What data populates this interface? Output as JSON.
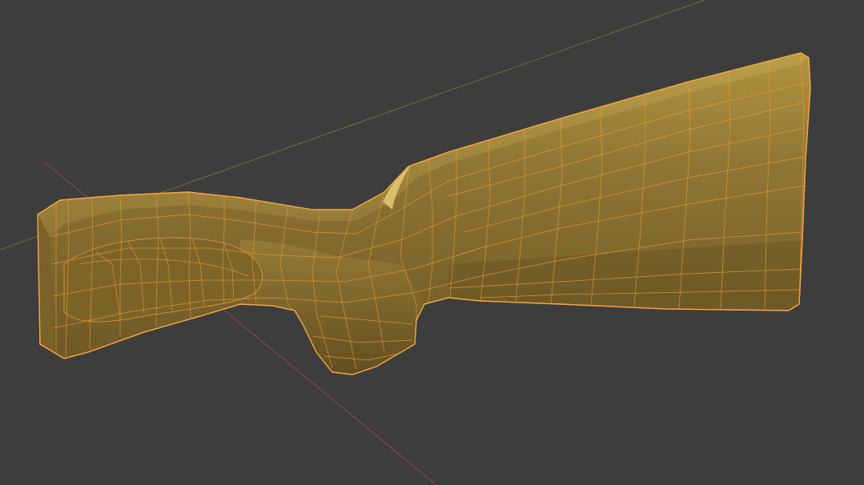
{
  "viewport": {
    "background_color": "#3d3d3d",
    "mode": "edit-mode-wireframe-on-shaded",
    "axes": {
      "x_axis_color": "#9a4a5c",
      "y_axis_color": "#6e7a44"
    },
    "object": {
      "type": "mesh",
      "depicts": "rifle-buttstock",
      "surface_color": "#8c7434",
      "wire_color": "#f09a32",
      "selected": true
    }
  }
}
